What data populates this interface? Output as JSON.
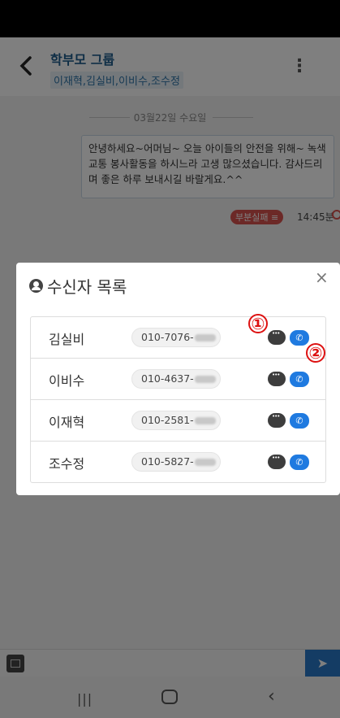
{
  "header": {
    "group_title": "학부모 그룹",
    "members": "이재혁,김실비,이비수,조수정",
    "back_icon": "chevron-left-icon",
    "menu_glyph": "⋮"
  },
  "chat": {
    "date_label": "03월22일 수요일",
    "message_text": "안녕하세요~어머님~ 오늘 아이들의 안전을 위해~ 녹색 교통 봉사활동을 하시느라 고생 많으셨습니다. 감사드리며 좋은 하루 보내시길 바랄게요.^^",
    "status_badge": "부분실패 ≡",
    "time": "14:45분"
  },
  "modal": {
    "title": "수신자 목록",
    "close_glyph": "×",
    "recipients": [
      {
        "name": "김실비",
        "phone": "010-7076-"
      },
      {
        "name": "이비수",
        "phone": "010-4637-"
      },
      {
        "name": "이재혁",
        "phone": "010-2581-"
      },
      {
        "name": "조수정",
        "phone": "010-5827-"
      }
    ]
  },
  "annotations": {
    "marker_1": "①",
    "marker_2": "②"
  },
  "input": {
    "send_glyph": "➤"
  },
  "nav": {
    "recent_glyph": "|||",
    "back_glyph": "‹"
  },
  "colors": {
    "accent": "#1f7ae0",
    "header_title": "#1f5d8c",
    "status_fail": "#d9534f",
    "send": "#2979c9"
  }
}
